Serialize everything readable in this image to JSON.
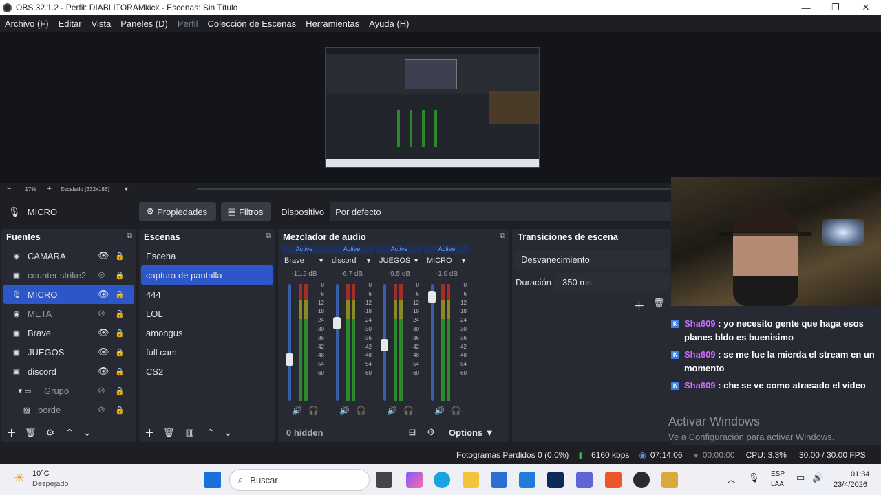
{
  "window": {
    "title": "OBS 32.1.2 - Perfil: DIABLITORAMkick - Escenas: Sin Título"
  },
  "menu": [
    "Archivo (F)",
    "Editar",
    "Vista",
    "Paneles (D)",
    "Perfil",
    "Colección de Escenas",
    "Herramientas",
    "Ayuda (H)"
  ],
  "zoom": {
    "minus": "−",
    "level": "17%",
    "plus": "+",
    "scale": "Escalado (332x186)"
  },
  "context": {
    "source": "MICRO",
    "props": "Propiedades",
    "filters": "Filtros",
    "device_label": "Dispositivo",
    "device_value": "Por defecto"
  },
  "sources": {
    "title": "Fuentes",
    "items": [
      {
        "name": "CAMARA",
        "icon": "camera-icon",
        "visible": true
      },
      {
        "name": "counter strike2",
        "icon": "window-capture-icon",
        "visible": false
      },
      {
        "name": "MICRO",
        "icon": "mic-icon",
        "visible": true
      },
      {
        "name": "META",
        "icon": "camera-icon",
        "visible": false
      },
      {
        "name": "Brave",
        "icon": "window-capture-icon",
        "visible": true
      },
      {
        "name": "JUEGOS",
        "icon": "window-capture-icon",
        "visible": true
      },
      {
        "name": "discord",
        "icon": "window-capture-icon",
        "visible": true
      },
      {
        "name": "Grupo",
        "icon": "folder-icon",
        "visible": false
      },
      {
        "name": "borde",
        "icon": "image-icon",
        "visible": false
      }
    ]
  },
  "scenes": {
    "title": "Escenas",
    "items": [
      "Escena",
      "captura de pantalla",
      "444",
      "LOL",
      "amongus",
      "full cam",
      "CS2"
    ]
  },
  "mixer": {
    "title": "Mezclador de audio",
    "hidden": "0 hidden",
    "options": "Options",
    "channels": [
      {
        "active": "Active",
        "name": "Brave",
        "db": "-11.2 dB",
        "level": 0.37
      },
      {
        "active": "Active",
        "name": "discord",
        "db": "-6.7 dB",
        "level": 0.7
      },
      {
        "active": "Active",
        "name": "JUEGOS",
        "db": "-9.5 dB",
        "level": 0.5
      },
      {
        "active": "Active",
        "name": "MICRO",
        "db": "-1.0 dB",
        "level": 0.94
      }
    ],
    "scale": [
      "0",
      "-6",
      "-12",
      "-18",
      "-24",
      "-30",
      "-36",
      "-42",
      "-48",
      "-54",
      "-60"
    ]
  },
  "transitions": {
    "title": "Transiciones de escena",
    "type": "Desvanecimiento",
    "duration_label": "Duración",
    "duration_value": "350 ms"
  },
  "chat": [
    {
      "user": "Sha609",
      "text": " : yo necesito gente que haga esos planes bldo es buenisimo"
    },
    {
      "user": "Sha609",
      "text": " : se me fue la mierda el stream en un momento"
    },
    {
      "user": "Sha609",
      "text": " : che se ve como atrasado el video"
    }
  ],
  "watermark": {
    "line1": "Activar Windows",
    "line2": "Ve a Configuración para activar Windows."
  },
  "status": {
    "dropped": "Fotogramas Perdidos 0 (0.0%)",
    "kbps": "6160 kbps",
    "live_time": "07:14:06",
    "rec_time": "00:00:00",
    "cpu": "CPU: 3.3%",
    "fps": "30.00 / 30.00 FPS"
  },
  "taskbar": {
    "temp": "10°C",
    "weather": "Despejado",
    "search": "Buscar",
    "lang1": "ESP",
    "lang2": "LAA",
    "time": "01:34",
    "date": "23/4/2026"
  }
}
